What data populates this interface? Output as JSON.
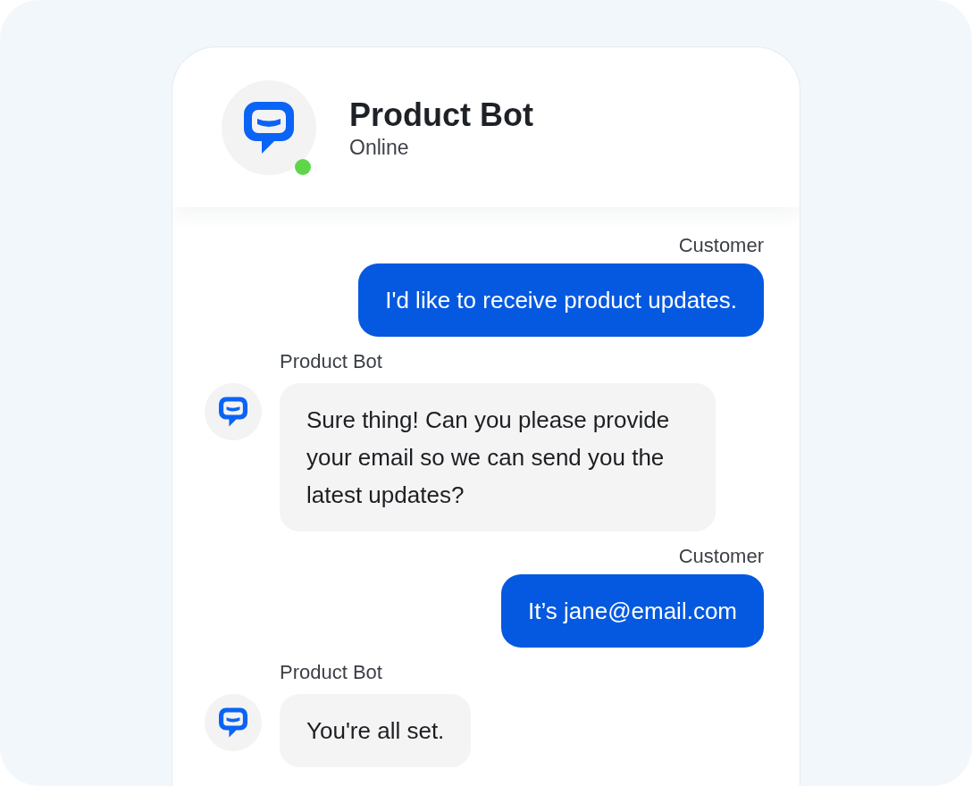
{
  "header": {
    "title": "Product Bot",
    "status": "Online",
    "online": true
  },
  "messages": [
    {
      "kind": "customer",
      "sender": "Customer",
      "text": "I'd like to receive product updates."
    },
    {
      "kind": "bot",
      "sender": "Product Bot",
      "text": "Sure thing! Can you please provide your email so we can send you the latest updates?"
    },
    {
      "kind": "customer",
      "sender": "Customer",
      "text": "It’s jane@email.com"
    },
    {
      "kind": "bot",
      "sender": "Product Bot",
      "text": "You're all set."
    }
  ]
}
